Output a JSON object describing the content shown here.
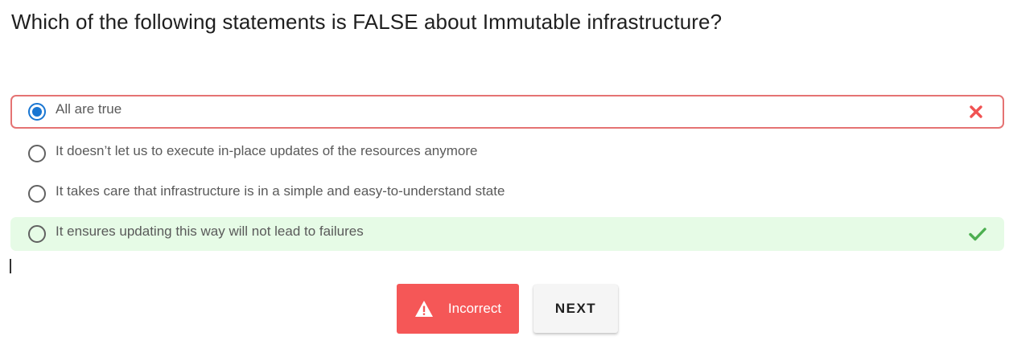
{
  "question": {
    "text": "Which of the following statements is FALSE about Immutable infrastructure?"
  },
  "options": [
    {
      "label": "All are true",
      "selected": true,
      "status": "incorrect",
      "status_icon": "close-icon"
    },
    {
      "label": "It doesn’t let us to execute in-place updates of the resources anymore",
      "selected": false,
      "status": "none"
    },
    {
      "label": "It takes care that infrastructure is in a simple and easy-to-understand state",
      "selected": false,
      "status": "none"
    },
    {
      "label": "It ensures updating this way will not lead to failures",
      "selected": false,
      "status": "correct",
      "status_icon": "check-icon"
    }
  ],
  "result_button": {
    "label": "Incorrect",
    "icon": "warning-icon"
  },
  "next_button": {
    "label": "NEXT"
  },
  "colors": {
    "incorrect_red": "#f55757",
    "wrong_border": "#e57373",
    "correct_bg": "#e6fbe6",
    "correct_green": "#4caf50",
    "radio_selected": "#1976d2"
  }
}
